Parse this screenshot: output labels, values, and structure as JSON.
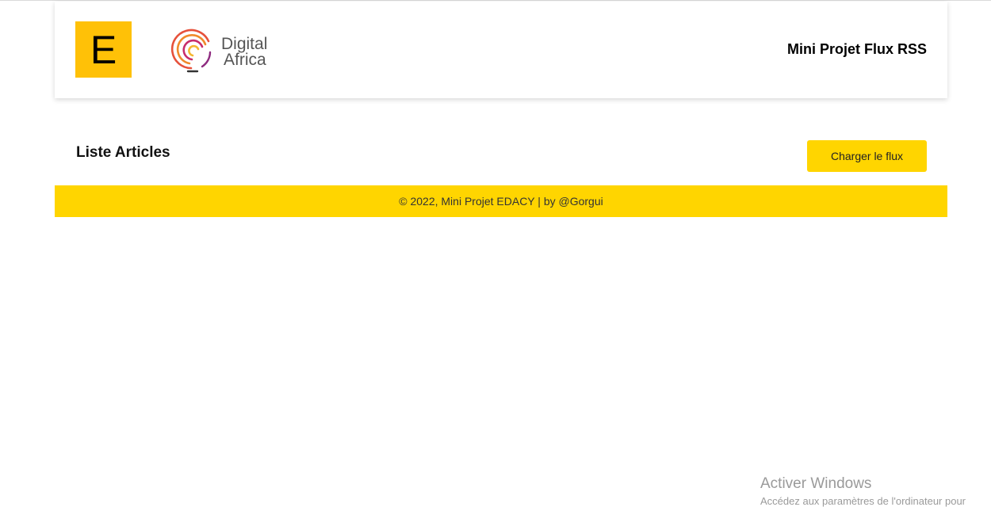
{
  "header": {
    "edacy_logo_letter": "E",
    "digital_africa_logo": {
      "line1": "Digital",
      "line2": "Africa"
    },
    "app_title": "Mini Projet Flux RSS"
  },
  "main": {
    "section_title": "Liste Articles",
    "load_button_label": "Charger le flux"
  },
  "footer": {
    "text": "© 2022, Mini Projet EDACY | by @Gorgui"
  },
  "os_watermark": {
    "title": "Activer Windows",
    "subtitle": "Accédez aux paramètres de l'ordinateur pour"
  },
  "colors": {
    "accent": "#FFD500",
    "edacy_logo_bg": "#FFC107"
  }
}
